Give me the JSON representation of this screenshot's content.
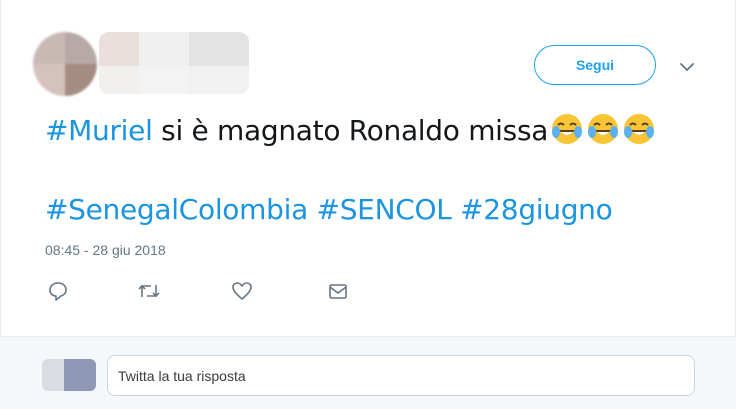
{
  "tweet": {
    "follow_label": "Segui",
    "text": {
      "hashtag": "#Muriel",
      "body": " si è magnato Ronaldo missa"
    },
    "emoji": [
      "face-with-tears-of-joy",
      "face-with-tears-of-joy",
      "face-with-tears-of-joy"
    ],
    "hashtags": [
      "#SenegalColombia",
      "#SENCOL",
      "#28giugno"
    ],
    "timestamp": "08:45 - 28 giu 2018",
    "actions": [
      "reply-icon",
      "retweet-icon",
      "like-icon",
      "message-icon"
    ]
  },
  "reply": {
    "placeholder": "Twitta la tua risposta"
  },
  "colors": {
    "accent": "#1da1f2",
    "hashtag": "#1b95e0",
    "muted": "#657786",
    "reply_bg": "#f5f8fa"
  }
}
